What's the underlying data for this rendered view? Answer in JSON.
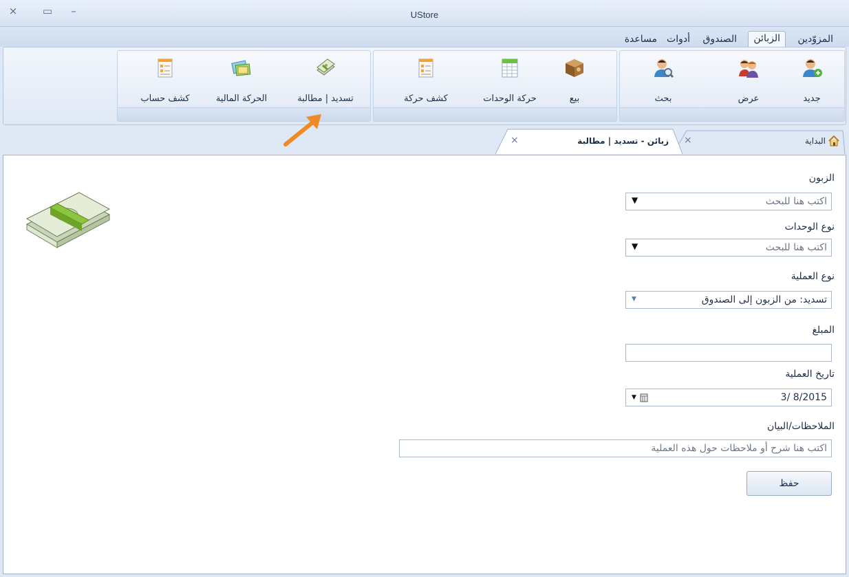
{
  "window": {
    "title": "UStore",
    "close": "×",
    "maximize": "▭",
    "minimize": "–"
  },
  "ribbon_tabs": [
    "المزوّدين",
    "الزبائن",
    "الصندوق",
    "أدوات",
    "مساعدة"
  ],
  "active_tab": "الزبائن",
  "ribbon": {
    "new_label": "جديد",
    "view_label": "عرض",
    "search_label": "بحث",
    "sell_label": "بيع",
    "units_movement_label": "حركة الوحدات",
    "movement_statement_label": "كشف حركة",
    "payment_claim_label": "تسديد | مطالبة",
    "financial_movement_label": "الحركة المالية",
    "account_statement_label": "كشف حساب"
  },
  "doc_tabs": {
    "home_label": "البداية",
    "active_label": "زبائن - تسديد | مطالبة",
    "close_glyph": "×"
  },
  "form": {
    "customer_label": "الزبون",
    "customer_placeholder": "اكتب هنا للبحث",
    "unit_type_label": "نوع الوحدات",
    "unit_type_placeholder": "اكتب هنا للبحث",
    "operation_type_label": "نوع العملية",
    "operation_type_value": "تسديد: من الزبون إلى الصندوق",
    "amount_label": "المبلغ",
    "amount_value": "",
    "date_label": "تاريخ العملية",
    "date_value": "3/ 8/2015",
    "notes_label": "الملاحظات/البيان",
    "notes_placeholder": "اكتب هنا شرح أو ملاحظات حول هذه العملية",
    "save_label": "حفظ"
  },
  "colors": {
    "accent_arrow": "#f08a24",
    "ribbon_bg": "#dfe8f5"
  },
  "icons": [
    "user-add-icon",
    "users-icon",
    "user-search-icon",
    "box-icon",
    "spreadsheet-icon",
    "document-icon",
    "money-icon",
    "cards-icon",
    "home-icon",
    "calendar-icon",
    "money-stack-icon"
  ]
}
